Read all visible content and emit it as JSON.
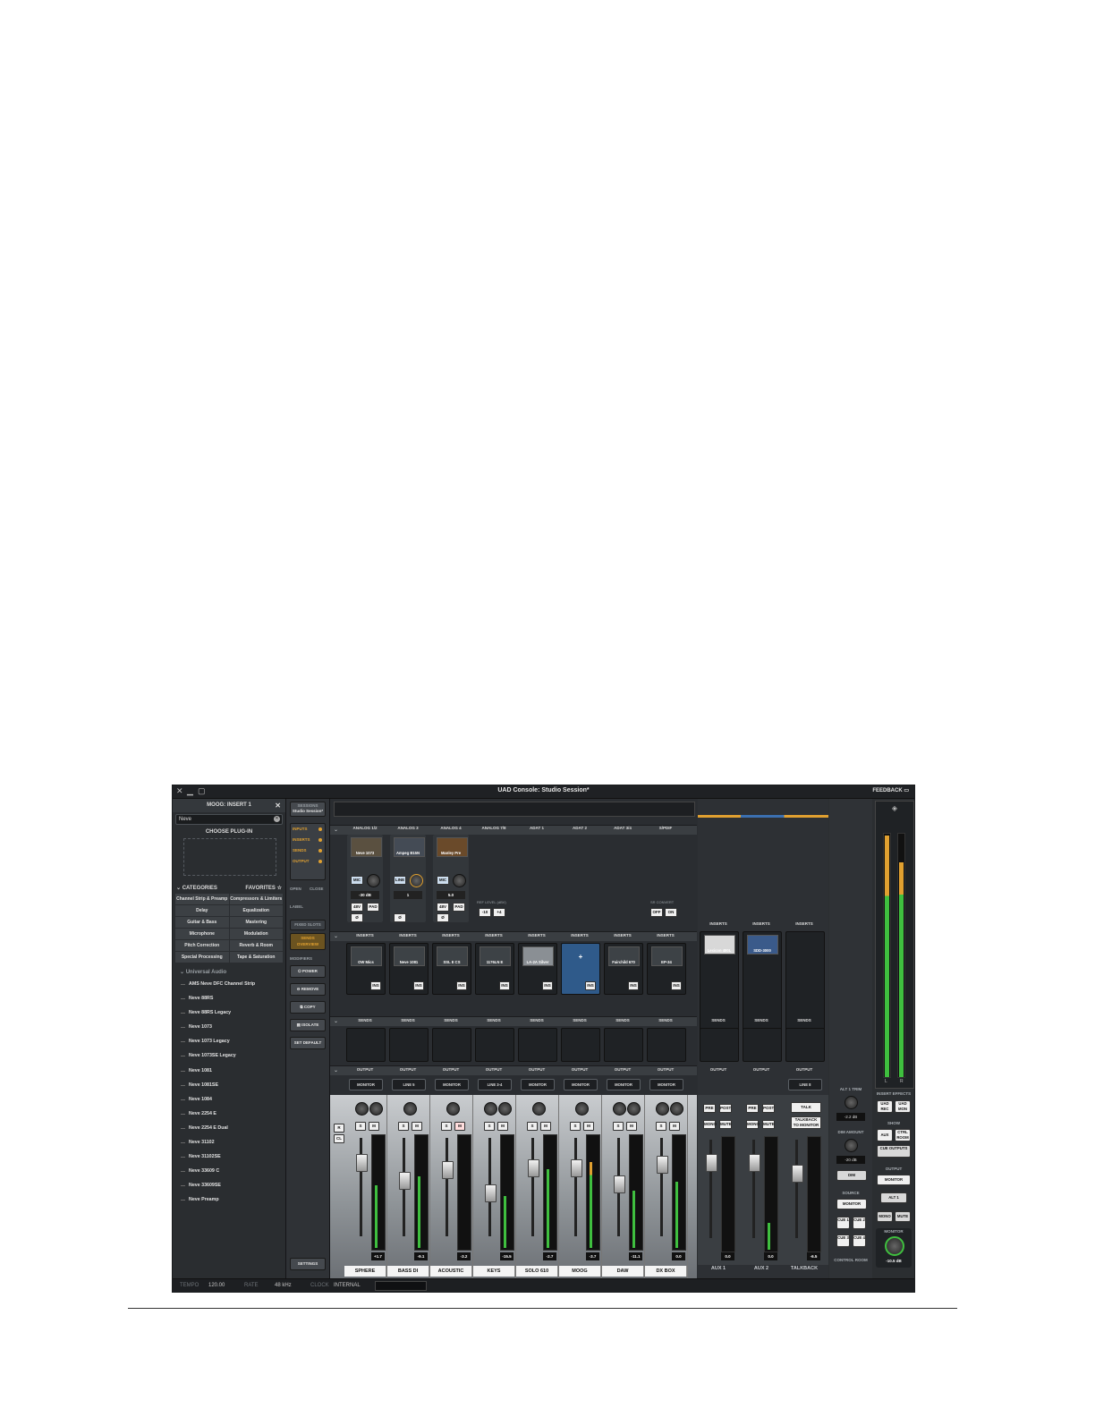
{
  "window": {
    "title": "UAD Console: Studio Session*",
    "feedback": "FEEDBACK"
  },
  "browser": {
    "header": "MOOG: INSERT 1",
    "search_value": "Neve",
    "choose": "CHOOSE PLUG-IN",
    "categories_label": "CATEGORIES",
    "favorites_label": "FAVORITES",
    "categories": [
      "Channel Strip & Preamp",
      "Compressors & Limiters",
      "Delay",
      "Equalization",
      "Guitar & Bass",
      "Mastering",
      "Microphone",
      "Modulation",
      "Pitch Correction",
      "Reverb & Room",
      "Special Processing",
      "Tape & Saturation"
    ],
    "vendor": "Universal Audio",
    "plugins": [
      "AMS Neve DFC Channel Strip",
      "Neve 88RS",
      "Neve 88RS Legacy",
      "Neve 1073",
      "Neve 1073 Legacy",
      "Neve 1073SE Legacy",
      "Neve 1081",
      "Neve 1081SE",
      "Neve 1084",
      "Neve 2254 E",
      "Neve 2254 E Dual",
      "Neve 31102",
      "Neve 31102SE",
      "Neve 33609 C",
      "Neve 33609SE",
      "Neve Preamp"
    ]
  },
  "leftcol": {
    "session_label": "SESSIONS",
    "session_name": "Studio Session*",
    "view": [
      "INPUTS",
      "INSERTS",
      "SENDS",
      "OUTPUT"
    ],
    "open": "OPEN",
    "close": "CLOSE",
    "label": "LABEL",
    "fixed_slots": "FIXED SLOTS",
    "sends_overview": "SENDS OVERVIEW",
    "modifiers": "MODIFIERS",
    "buttons": [
      "POWER",
      "REMOVE",
      "COPY",
      "ISOLATE",
      "SET DEFAULT"
    ],
    "settings": "SETTINGS"
  },
  "channels": [
    {
      "input": "ANALOG 1/2",
      "preamp": "Neve 1073",
      "gain": "-30 dB",
      "insert": "OW Mics",
      "output": "MONITOR",
      "value": "+1.7",
      "name": "SPHERE"
    },
    {
      "input": "ANALOG 3",
      "preamp": "Ampeg B15N",
      "gain": "1",
      "insert": "Neve 1081",
      "output": "LINE 5",
      "value": "-9.1",
      "name": "BASS DI"
    },
    {
      "input": "ANALOG 4",
      "preamp": "Manley Pre",
      "gain": "5.0",
      "insert": "SSL E CS",
      "output": "MONITOR",
      "value": "-3.2",
      "name": "ACOUSTIC"
    },
    {
      "input": "ANALOG 7/8",
      "preamp": "",
      "gain": "",
      "insert": "1176LN E",
      "output": "LINE 3-4",
      "value": "-15.5",
      "name": "KEYS"
    },
    {
      "input": "ADAT 1",
      "preamp": "",
      "gain": "",
      "insert": "LA-2A Silver",
      "output": "MONITOR",
      "value": "-2.7",
      "name": "SOLO 610"
    },
    {
      "input": "ADAT 2",
      "preamp": "",
      "gain": "",
      "insert": "",
      "output": "MONITOR",
      "value": "-3.7",
      "name": "MOOG"
    },
    {
      "input": "ADAT 3/4",
      "preamp": "",
      "gain": "",
      "insert": "Fairchild 670",
      "output": "MONITOR",
      "value": "-11.1",
      "name": "DAW"
    },
    {
      "input": "S/PDIF",
      "preamp": "",
      "gain": "",
      "insert": "EP-34",
      "output": "MONITOR",
      "value": "0.0",
      "name": "DX BOX"
    }
  ],
  "labels": {
    "inserts": "INSERTS",
    "sends": "SENDS",
    "output": "OUTPUT",
    "ref_level": "REF LEVEL (dBV)",
    "ref_m10": "-10",
    "ref_p4": "+4",
    "src_convert": "SR CONVERT",
    "off": "OFF",
    "on": "ON",
    "mic": "MIC",
    "line": "LINE",
    "v48": "48V",
    "pad": "PAD",
    "phase": "Ø",
    "ins": "INS",
    "s": "S",
    "m": "M",
    "pre": "PRE",
    "post": "POST",
    "mono": "MONO",
    "mute": "MUTE",
    "fader_r": "R",
    "fader_cl": "CL"
  },
  "aux": [
    {
      "insert": "Lexicon 480L",
      "value": "0.0",
      "name": "AUX 1",
      "output": "OUTPUT"
    },
    {
      "insert": "SDD-3000",
      "value": "0.0",
      "name": "AUX 2",
      "output": "OUTPUT"
    },
    {
      "insert": "",
      "value": "-6.5",
      "name": "TALKBACK",
      "output": "LINE 8",
      "talk": "TALK",
      "tb_monitor": "TALKBACK TO MONITOR"
    }
  ],
  "control_room": {
    "alt_trim": "ALT 1 TRIM",
    "alt_trim_val": "-2.2 dB",
    "dim_amount": "DIM AMOUNT",
    "dim_val": "-20 dB",
    "dim": "DIM",
    "source": "SOURCE",
    "monitor": "MONITOR",
    "cues": [
      "CUE 1",
      "CUE 2",
      "CUE 3",
      "CUE 4"
    ],
    "label": "CONTROL ROOM"
  },
  "right": {
    "insert_effects": "INSERT EFFECTS",
    "uad_rec": "UAD REC",
    "uad_mon": "UAD MON",
    "show": "SHOW",
    "aux": "AUX",
    "ctrl_room": "CTRL ROOM",
    "cue_outputs": "CUE OUTPUTS",
    "output": "OUTPUT",
    "monitor": "MONITOR",
    "alt1": "ALT 1",
    "mono": "MONO",
    "mute": "MUTE",
    "monitor_knob": "MONITOR",
    "monitor_val": "-10.5 dB",
    "l": "L",
    "r": "R"
  },
  "statusbar": {
    "tempo_label": "TEMPO",
    "tempo": "120.00",
    "rate_label": "RATE",
    "rate": "48 kHz",
    "clock_label": "CLOCK",
    "clock": "INTERNAL"
  },
  "colors": {
    "accent": "#e0a030",
    "meter": "#3fbf3f",
    "panel": "#2b2e31"
  }
}
